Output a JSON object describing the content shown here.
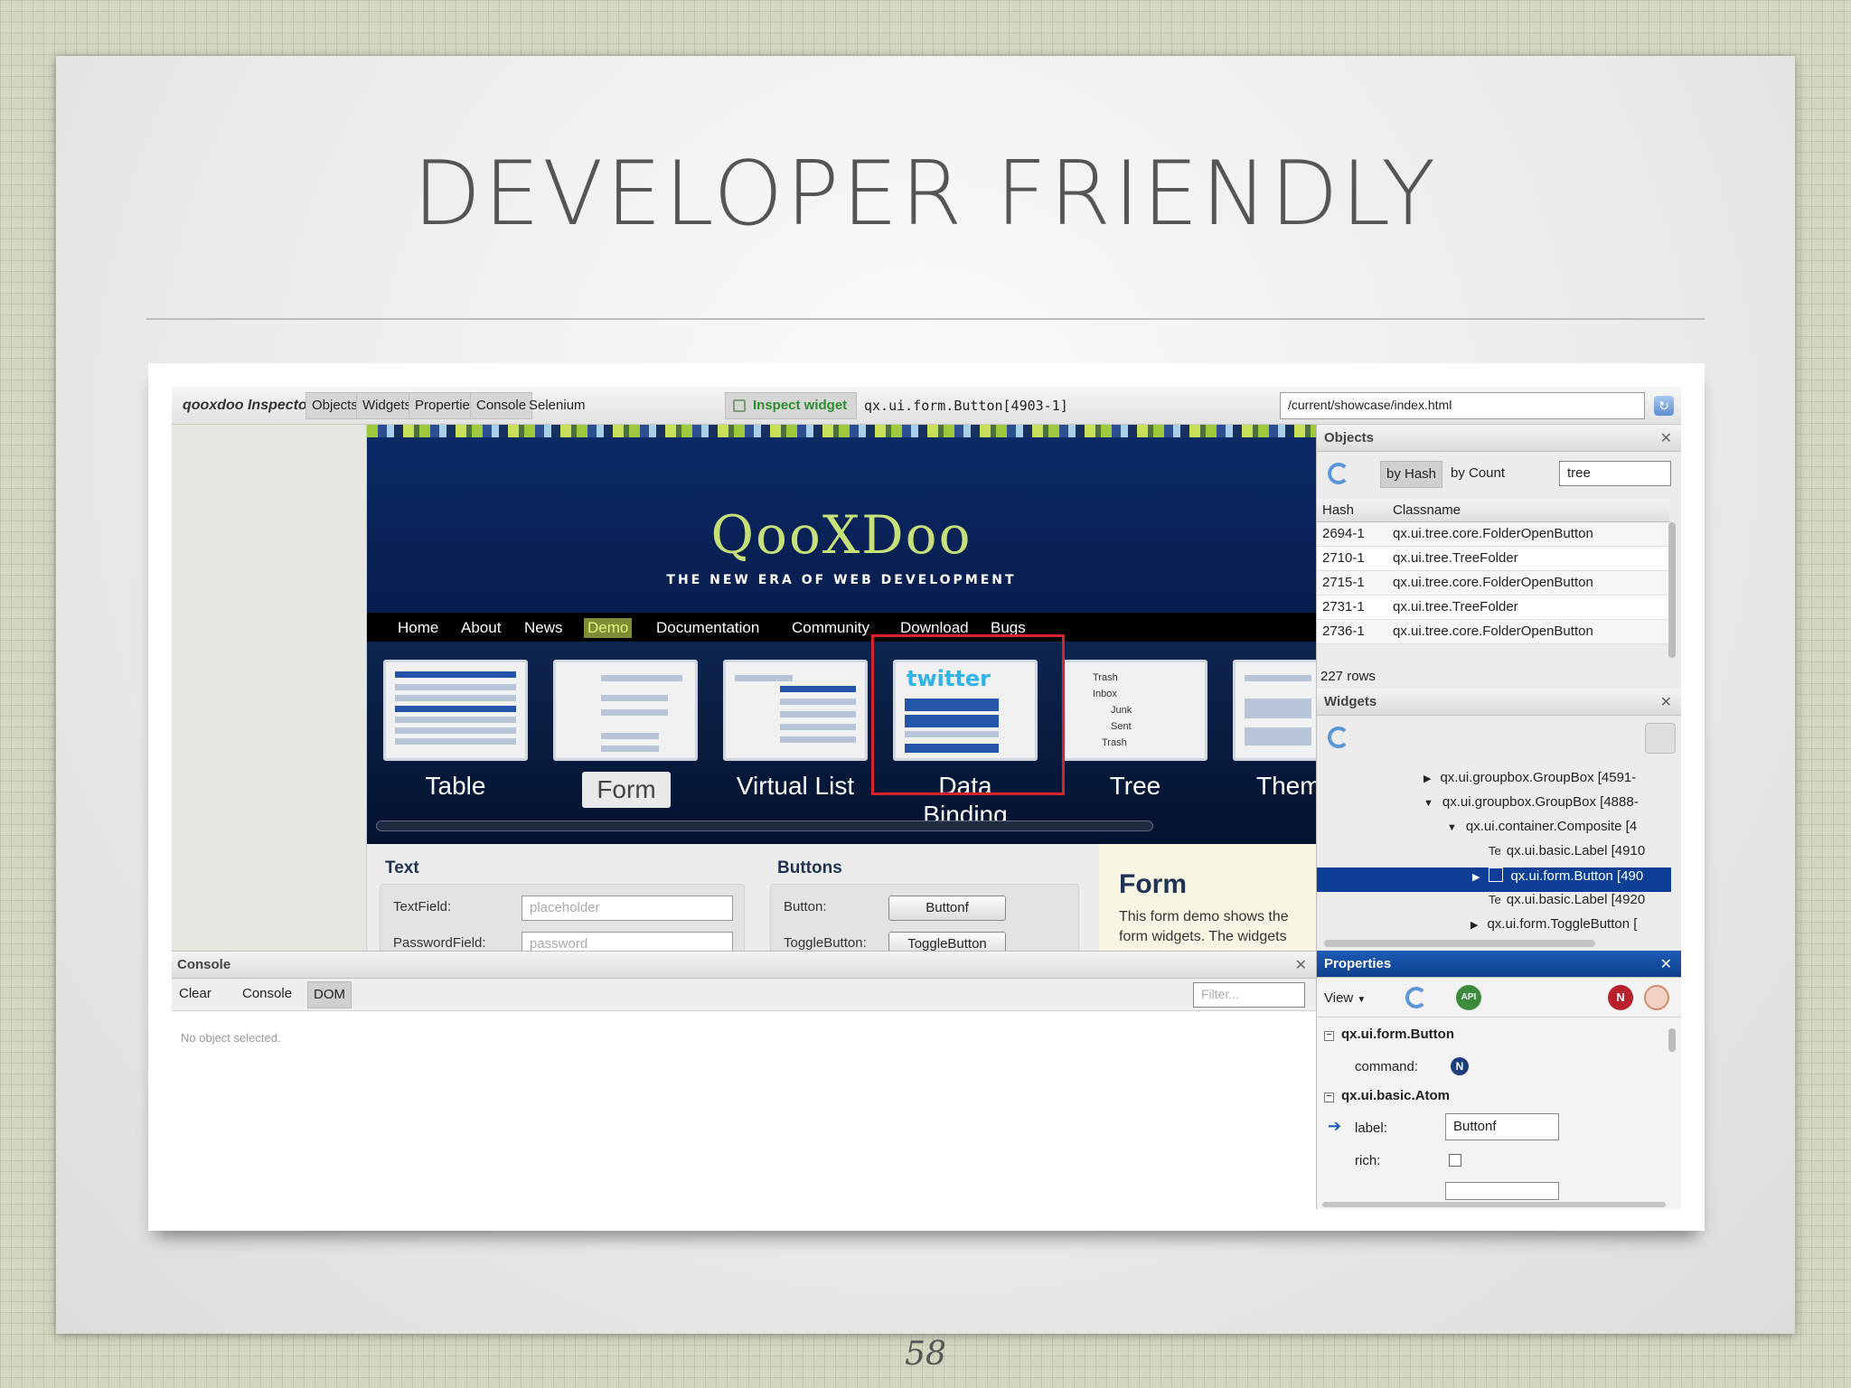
{
  "slide": {
    "title": "DEVELOPER FRIENDLY",
    "page_number": "58"
  },
  "toolbar": {
    "app_title": "qooxdoo Inspector",
    "buttons": [
      "Objects",
      "Widgets",
      "Properties",
      "Console",
      "Selenium"
    ],
    "inspect_label": "Inspect widget",
    "selected_widget": "qx.ui.form.Button[4903-1]",
    "url": "/current/showcase/index.html"
  },
  "site": {
    "logo": "QooXDoo",
    "tagline": "THE NEW ERA OF WEB DEVELOPMENT",
    "nav": [
      "Home",
      "About",
      "News",
      "Demo",
      "Documentation",
      "Community",
      "Download",
      "Bugs"
    ],
    "nav_active": "Demo",
    "demos": [
      "Table",
      "Form",
      "Virtual List",
      "Data Binding",
      "Tree",
      "Them"
    ],
    "twitter_logo": "twitter",
    "tree_thumb_items": [
      "Trash",
      "Inbox",
      "Junk",
      "Sent",
      "Trash"
    ],
    "text_section": {
      "title": "Text",
      "textfield_label": "TextField:",
      "textfield_placeholder": "placeholder",
      "password_label": "PasswordField:",
      "password_placeholder": "password"
    },
    "buttons_section": {
      "title": "Buttons",
      "button_label": "Button:",
      "button_text": "Buttonf",
      "togglebutton_label": "ToggleButton:",
      "togglebutton_text": "ToggleButton"
    },
    "form_info": {
      "title": "Form",
      "text": "This form demo shows the form widgets. The widgets"
    }
  },
  "objects": {
    "title": "Objects",
    "by_hash": "by Hash",
    "by_count": "by Count",
    "filter": "tree",
    "columns": [
      "Hash",
      "Classname"
    ],
    "rows": [
      {
        "hash": "2694-1",
        "classname": "qx.ui.tree.core.FolderOpenButton"
      },
      {
        "hash": "2710-1",
        "classname": "qx.ui.tree.TreeFolder"
      },
      {
        "hash": "2715-1",
        "classname": "qx.ui.tree.core.FolderOpenButton"
      },
      {
        "hash": "2731-1",
        "classname": "qx.ui.tree.TreeFolder"
      },
      {
        "hash": "2736-1",
        "classname": "qx.ui.tree.core.FolderOpenButton"
      }
    ],
    "row_count": "227 rows"
  },
  "widgets": {
    "title": "Widgets",
    "tree": [
      "qx.ui.groupbox.GroupBox [4591-",
      "qx.ui.groupbox.GroupBox [4888-",
      "qx.ui.container.Composite [4",
      "qx.ui.basic.Label [4910",
      "qx.ui.form.Button [490",
      "qx.ui.basic.Label [4920",
      "qx.ui.form.ToggleButton ["
    ]
  },
  "console": {
    "title": "Console",
    "tabs": [
      "Clear",
      "Console",
      "DOM"
    ],
    "filter_placeholder": "Filter...",
    "message": "No object selected."
  },
  "properties": {
    "title": "Properties",
    "view_label": "View",
    "api_icon_text": "API",
    "null_icon_text": "N",
    "group1": "qx.ui.form.Button",
    "command_label": "command:",
    "group2": "qx.ui.basic.Atom",
    "label_label": "label:",
    "label_value": "Buttonf",
    "rich_label": "rich:"
  }
}
